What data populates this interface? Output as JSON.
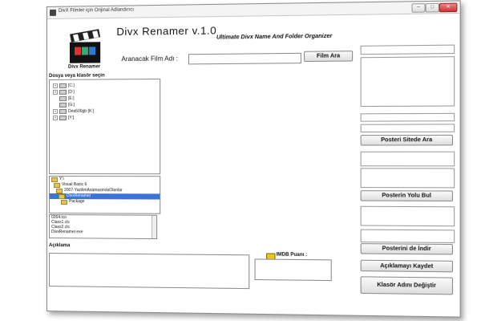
{
  "window": {
    "title": "DivX Filmler için Orijinal Adlandırıcı",
    "controls": {
      "minimize": "–",
      "maximize": "□",
      "close": "✕"
    }
  },
  "header": {
    "logo_caption": "Divx Renamer",
    "app_title": "Divx Renamer v.1.0",
    "subtitle": "Ultimate Divx Name And Folder Organizer"
  },
  "search": {
    "label": "Aranacak Film Adı :",
    "value": "",
    "button": "Film Ara"
  },
  "drives": {
    "label": "Dosya veya klasör seçin",
    "items": [
      {
        "label": "[C:]",
        "expander": "+"
      },
      {
        "label": "[D:]",
        "expander": "+"
      },
      {
        "label": "[E:]",
        "expander": ""
      },
      {
        "label": "[G:]",
        "expander": ""
      },
      {
        "label": "Dea500gb [K:]",
        "expander": "+"
      },
      {
        "label": "[Y:]",
        "expander": "+"
      }
    ]
  },
  "folders": {
    "items": [
      {
        "label": "Y:\\",
        "selected": false
      },
      {
        "label": "Visual Basic 6",
        "selected": false
      },
      {
        "label": "2007-YazilimAsamasindaOlanlar",
        "selected": false
      },
      {
        "label": "DivxRenamer",
        "selected": true
      },
      {
        "label": "Package",
        "selected": false
      }
    ]
  },
  "files": {
    "items": [
      "0264.ico",
      "Class1.cls",
      "Class2.cls",
      "DivxRenamer.exe"
    ]
  },
  "description": {
    "label": "Açıklama",
    "value": ""
  },
  "imdb": {
    "label": "IMDB Puanı :",
    "value": ""
  },
  "right_panel": {
    "buttons": {
      "search_poster": "Posteri Sitede Ara",
      "find_poster_path": "Posterin Yolu Bul",
      "download_poster": "Posterini de İndir",
      "save_description": "Açıklamayı Kaydet",
      "rename_folder": "Klasör Adını Değiştir"
    }
  }
}
